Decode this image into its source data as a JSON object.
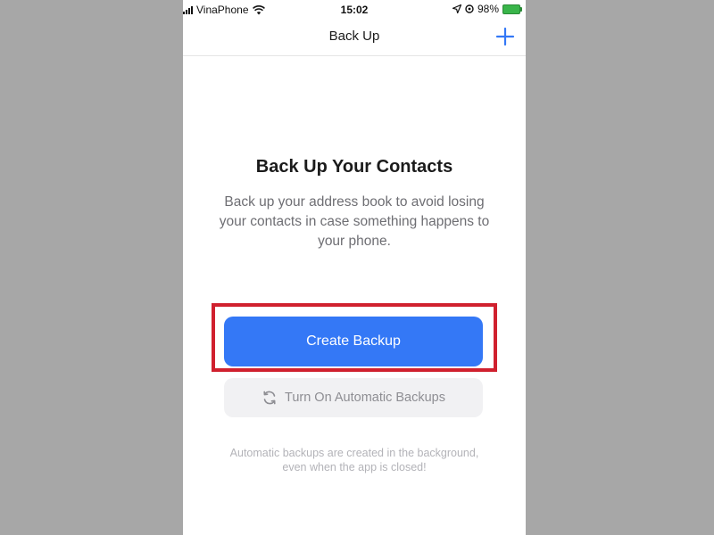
{
  "status_bar": {
    "carrier": "VinaPhone",
    "time": "15:02",
    "battery_percent": "98%",
    "battery_color": "#39b54a"
  },
  "nav": {
    "title": "Back Up",
    "add_icon": "plus-icon",
    "accent_color": "#3478f6"
  },
  "content": {
    "headline": "Back Up Your Contacts",
    "description": "Back up your address book to avoid losing your contacts in case something happens to your phone."
  },
  "actions": {
    "primary_label": "Create Backup",
    "secondary_label": "Turn On Automatic Backups",
    "secondary_icon": "sync-icon",
    "highlight_color": "#d0202e"
  },
  "footnote": "Automatic backups are created in the background, even when the app is closed!"
}
